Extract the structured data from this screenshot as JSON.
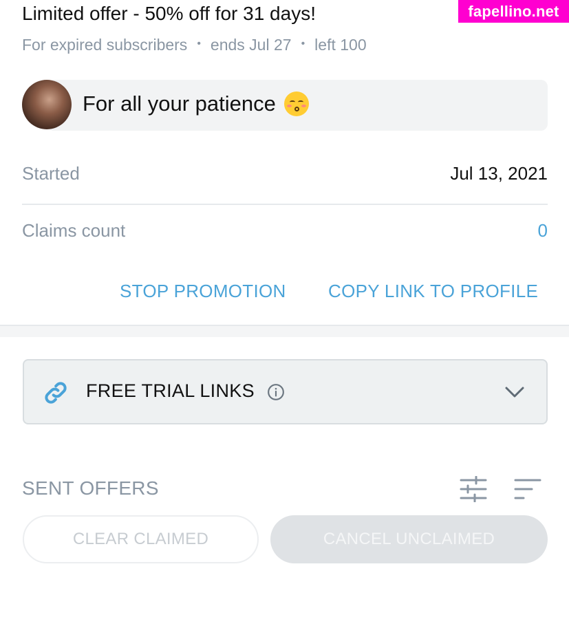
{
  "watermark": "fapellino.net",
  "offer": {
    "title": "Limited offer - 50% off for 31 days!",
    "audience": "For expired subscribers",
    "ends": "ends Jul 27",
    "left": "left 100",
    "separator": "•"
  },
  "message": {
    "text": "For all your patience",
    "emoji_icon": "kissing-face-emoji-icon"
  },
  "stats": {
    "started_label": "Started",
    "started_value": "Jul 13, 2021",
    "claims_label": "Claims count",
    "claims_value": "0"
  },
  "actions": {
    "stop_label": "STOP PROMOTION",
    "copy_label": "COPY LINK TO PROFILE"
  },
  "trial_links": {
    "title": "FREE TRIAL LINKS",
    "icons": [
      "link-icon",
      "info-icon",
      "chevron-down-icon"
    ]
  },
  "sent_offers": {
    "title": "SENT OFFERS",
    "icons": [
      "filter-sliders-icon",
      "sort-icon"
    ],
    "clear_label": "CLEAR CLAIMED",
    "cancel_label": "CANCEL UNCLAIMED"
  },
  "colors": {
    "accent": "#4aa3d8",
    "muted_text": "#8a96a3",
    "watermark_bg": "#ff00d0",
    "panel_bg": "#eef1f2"
  }
}
